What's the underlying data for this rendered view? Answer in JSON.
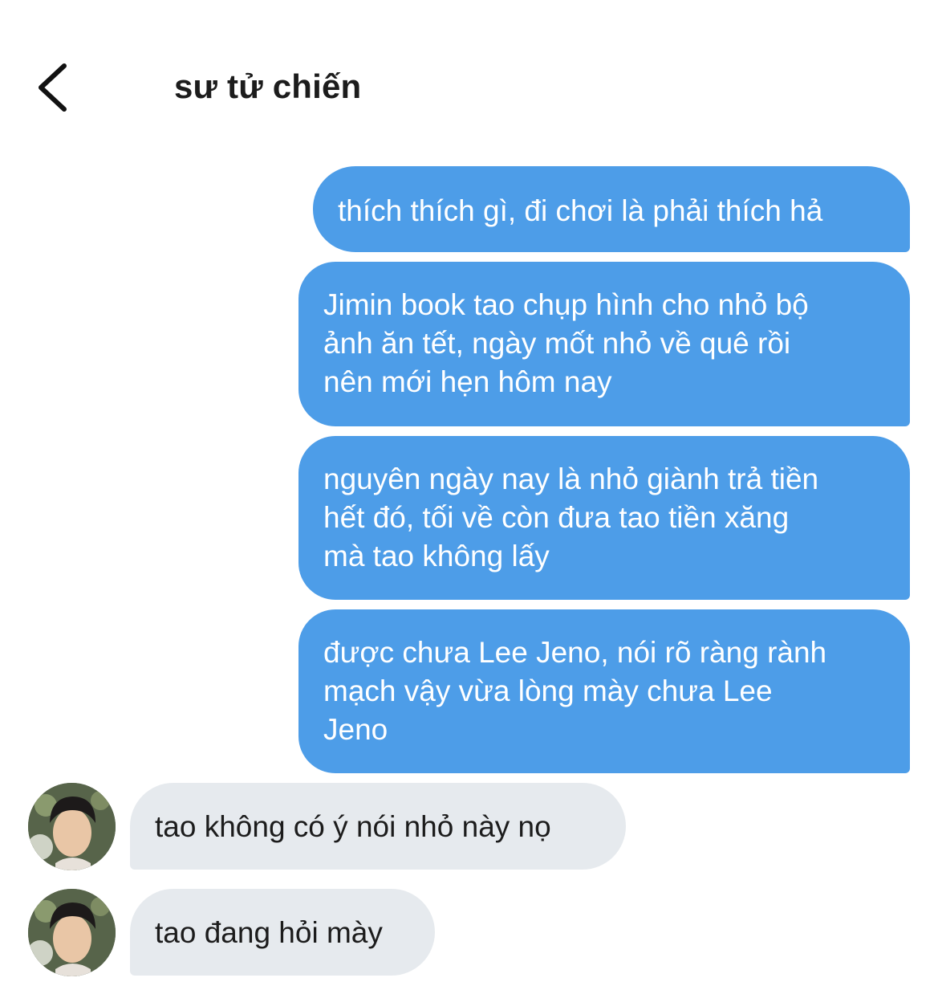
{
  "header": {
    "back_icon": "chevron-left-icon",
    "title": "sư tử chiến"
  },
  "messages": {
    "outgoing": [
      {
        "line1": "thích thích gì, đi chơi là phải thích hả"
      },
      {
        "line1": "Jimin book tao chụp hình cho nhỏ bộ",
        "line2": "ảnh ăn tết, ngày mốt nhỏ về quê rồi",
        "line3": "nên mới hẹn hôm nay"
      },
      {
        "line1": "nguyên ngày nay là nhỏ giành trả tiền",
        "line2": "hết đó, tối về còn đưa tao tiền xăng",
        "line3": "mà tao không lấy"
      },
      {
        "line1": "được chưa Lee Jeno, nói rõ ràng rành",
        "line2": "mạch vậy vừa lòng mày chưa Lee",
        "line3": "Jeno"
      }
    ],
    "incoming": [
      {
        "text": "tao không có ý nói nhỏ này nọ"
      },
      {
        "text": "tao đang hỏi mày"
      }
    ]
  },
  "colors": {
    "outgoing_bubble": "#4d9de8",
    "incoming_bubble": "#e6eaee",
    "background": "#ffffff"
  }
}
